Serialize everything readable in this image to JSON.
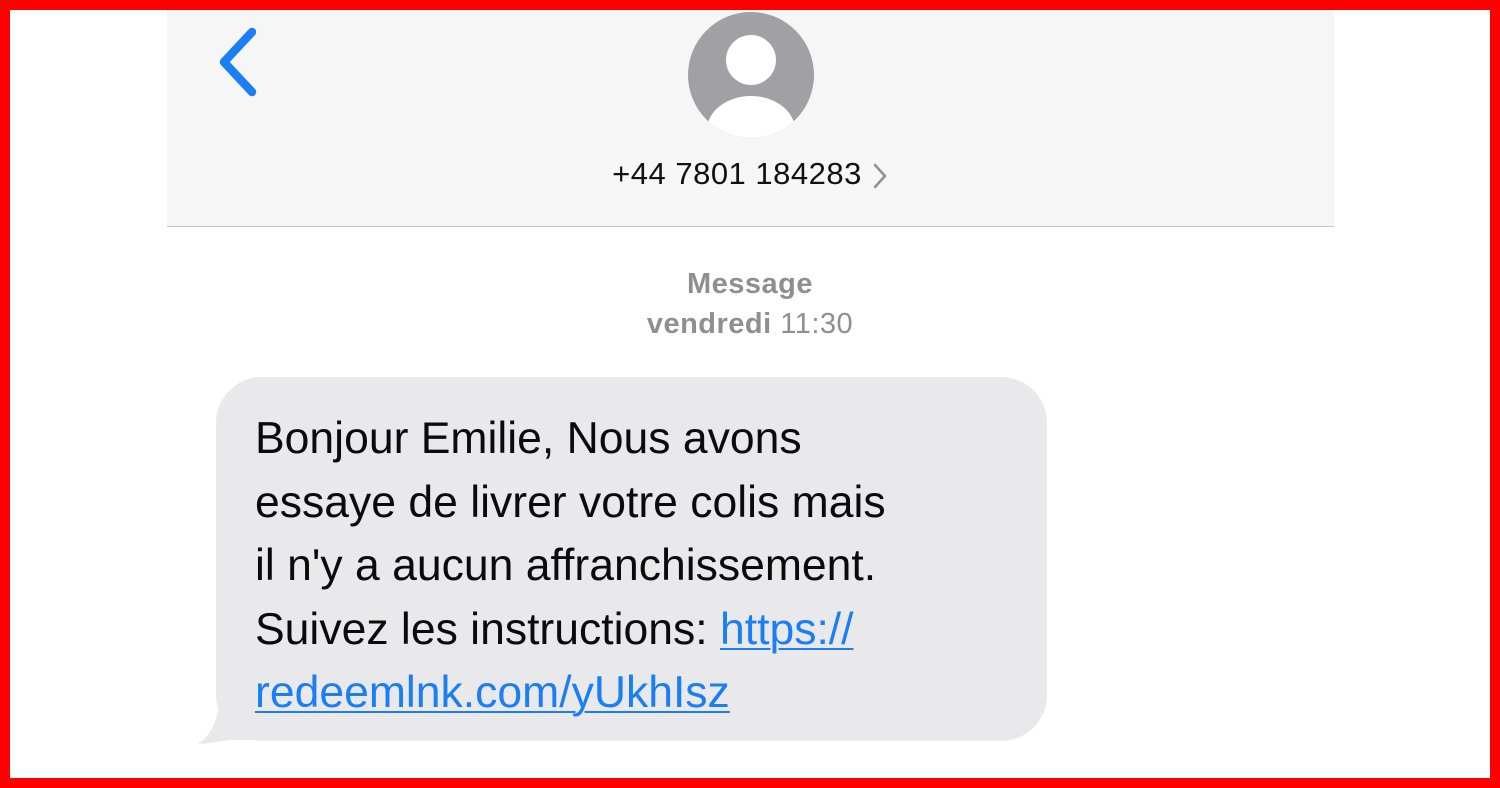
{
  "colors": {
    "accent": "#1a7ef5",
    "frame": "#ff0000",
    "bubble_bg": "#e9e9eb",
    "header_bg": "#f6f6f6",
    "avatar_bg": "#a0a0a5",
    "meta_text": "#8e8e93"
  },
  "header": {
    "back_icon": "chevron-left-icon",
    "avatar_icon": "person-icon",
    "contact_number": "+44 7801 184283",
    "contact_chevron_icon": "chevron-right-icon"
  },
  "conversation": {
    "service_label": "Message",
    "timestamp_day": "vendredi",
    "timestamp_time": "11:30",
    "message": {
      "lines": [
        "Bonjour Emilie, Nous avons",
        "essaye de livrer votre colis mais",
        "il n'y a aucun affranchissement.",
        "Suivez les instructions: "
      ],
      "link_part1": "https://",
      "link_part2": "redeemlnk.com/yUkhIsz"
    }
  }
}
